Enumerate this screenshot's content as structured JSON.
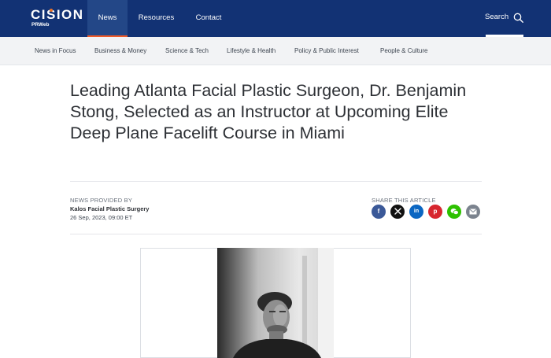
{
  "brand": {
    "logo_text": "CISION",
    "logo_sub": "PRWeb"
  },
  "nav": {
    "news": "News",
    "resources": "Resources",
    "contact": "Contact",
    "search": "Search"
  },
  "subnav": [
    "News in Focus",
    "Business & Money",
    "Science & Tech",
    "Lifestyle & Health",
    "Policy & Public Interest",
    "People & Culture"
  ],
  "article": {
    "headline": "Leading Atlanta Facial Plastic Surgeon, Dr. Benjamin Stong, Selected as an Instructor at Upcoming Elite Deep Plane Facelift Course in Miami",
    "provided_label": "NEWS PROVIDED BY",
    "provider": "Kalos Facial Plastic Surgery",
    "date": "26 Sep, 2023, 09:00 ET",
    "share_label": "SHARE THIS ARTICLE"
  },
  "share_buttons": [
    {
      "name": "facebook",
      "icon": "facebook-icon",
      "color": "#3b5998",
      "glyph": "f"
    },
    {
      "name": "x",
      "icon": "x-icon",
      "color": "#111111",
      "glyph": "𝕏"
    },
    {
      "name": "linkedin",
      "icon": "linkedin-icon",
      "color": "#0a66c2",
      "glyph": "in"
    },
    {
      "name": "pinterest",
      "icon": "pinterest-icon",
      "color": "#d7262e",
      "glyph": "p"
    },
    {
      "name": "wechat",
      "icon": "wechat-icon",
      "color": "#2dc100",
      "glyph": "wechat"
    },
    {
      "name": "email",
      "icon": "email-icon",
      "color": "#7b838e",
      "glyph": "email"
    }
  ],
  "colors": {
    "header_bg": "#123274",
    "active_nav": "#234787",
    "accent": "#f05a28"
  }
}
